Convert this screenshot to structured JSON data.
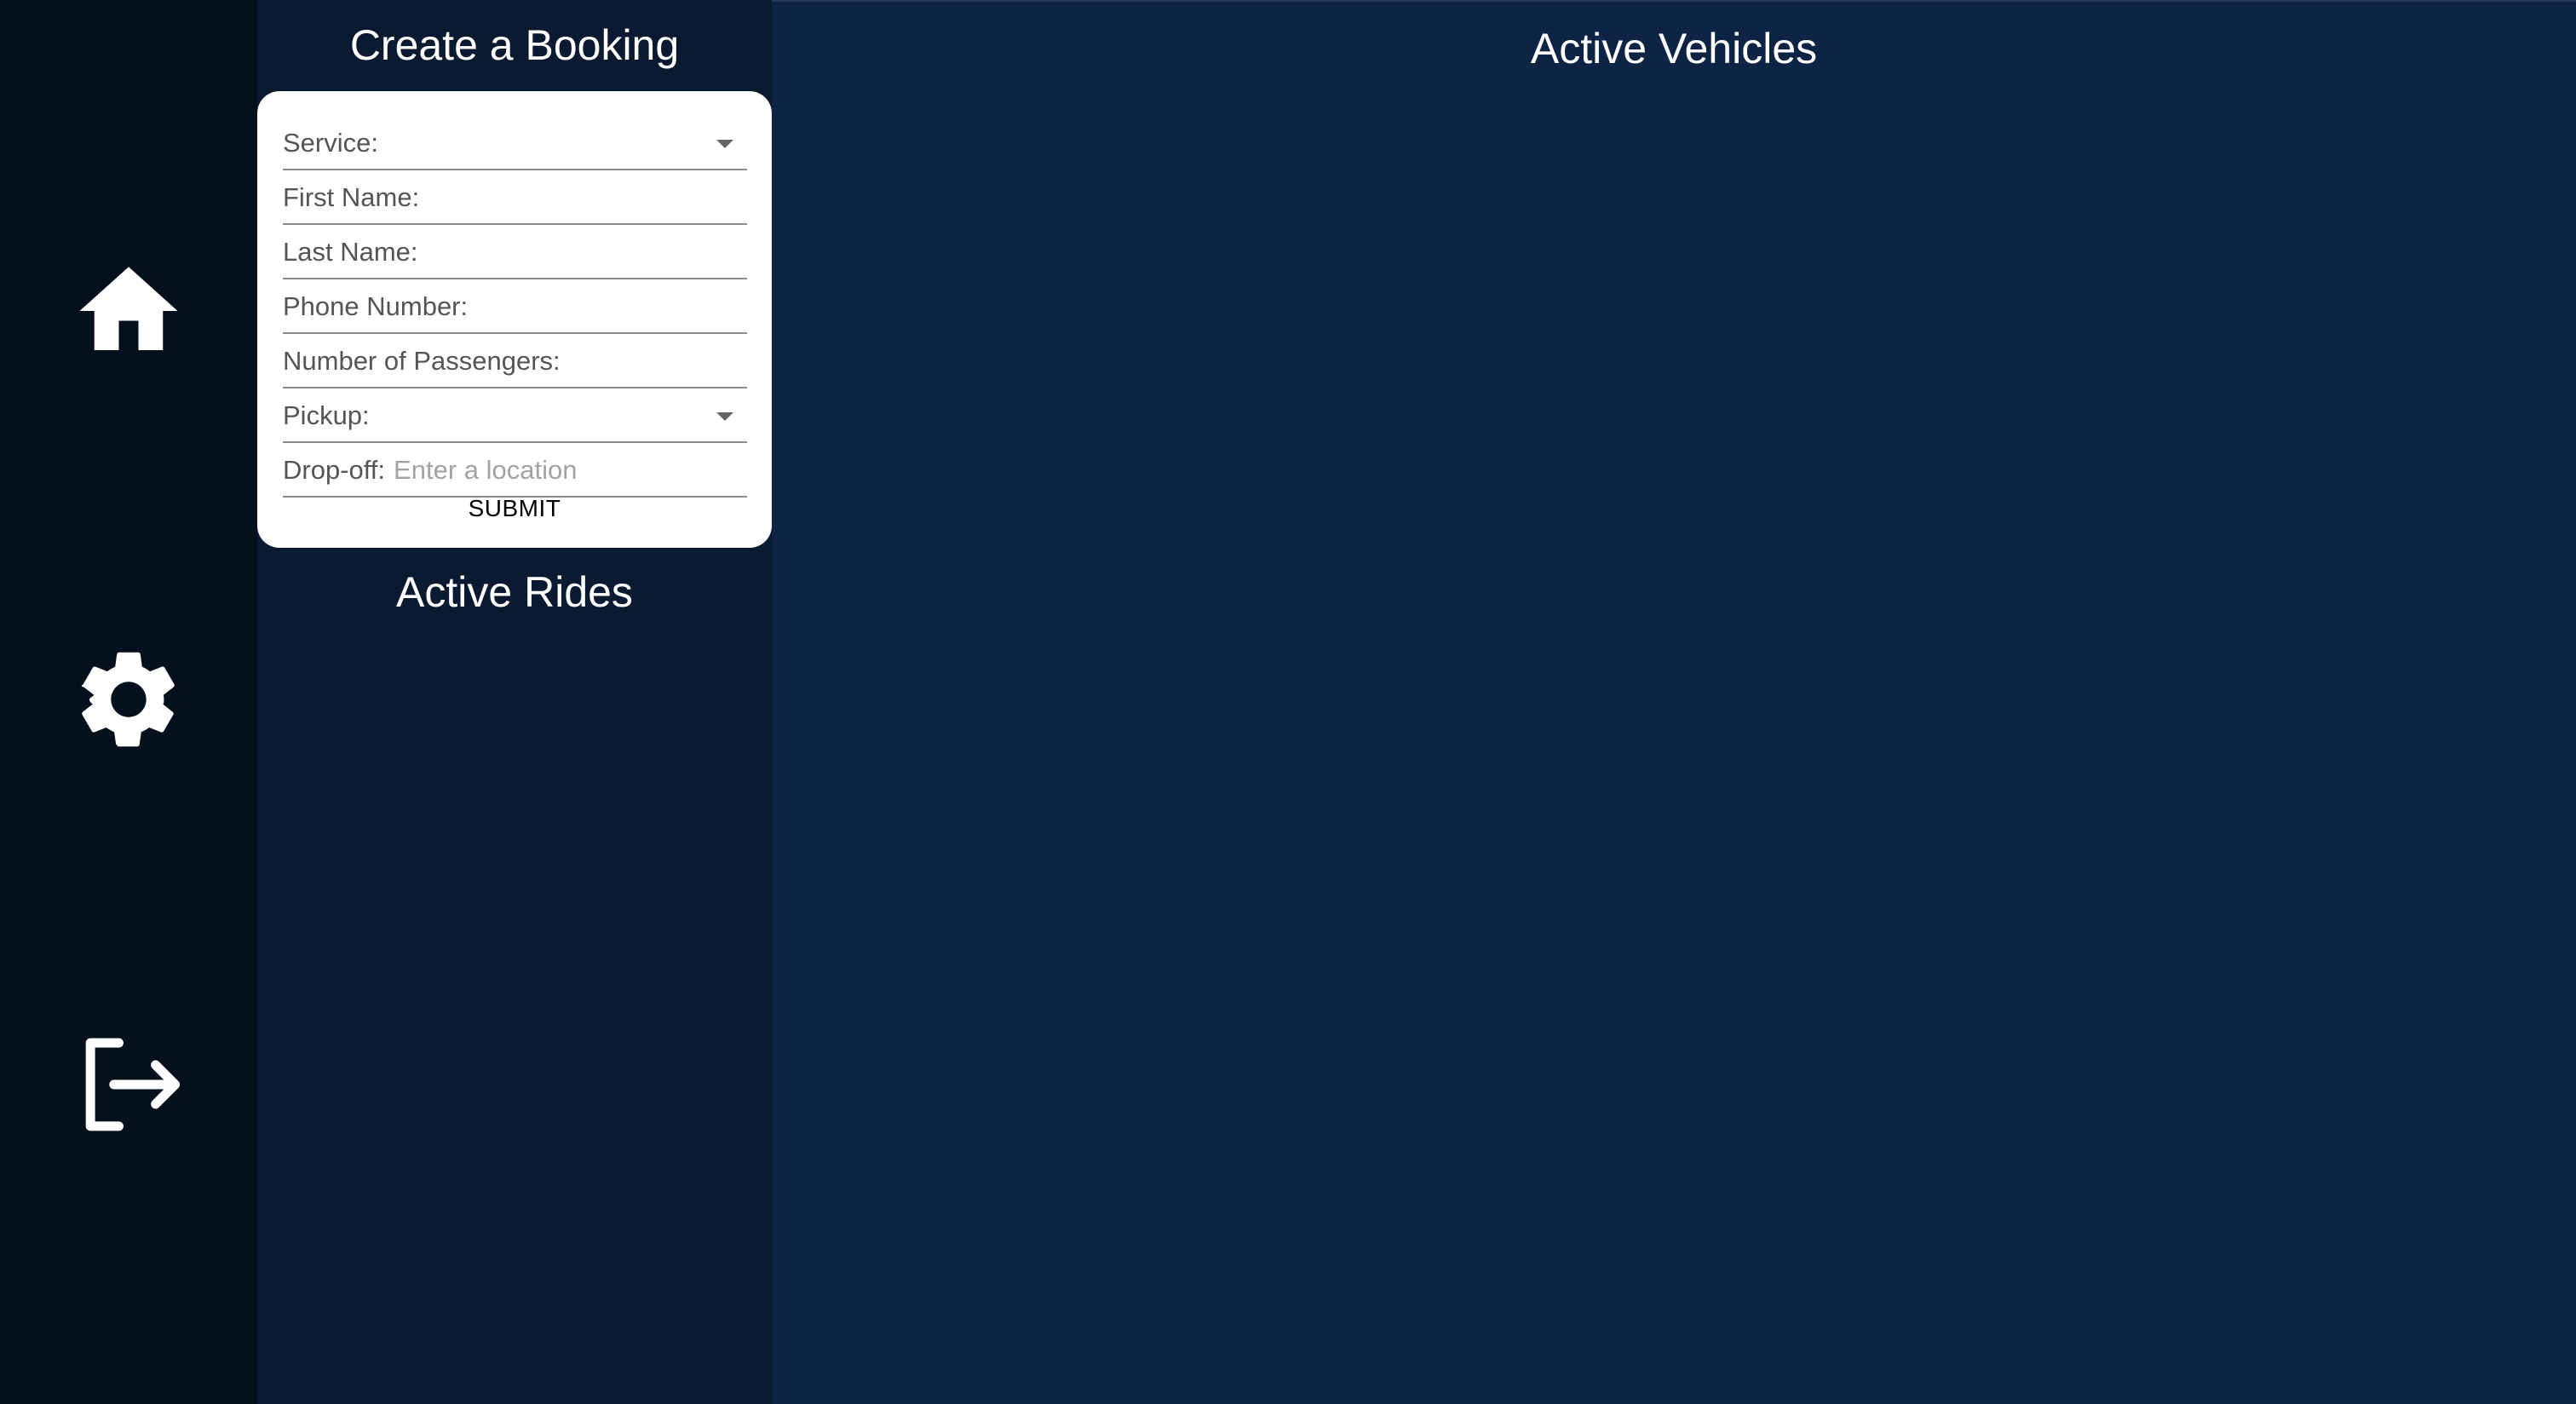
{
  "nav": {
    "items": [
      {
        "name": "home",
        "icon": "home-icon"
      },
      {
        "name": "settings",
        "icon": "gear-icon"
      },
      {
        "name": "logout",
        "icon": "logout-icon"
      }
    ]
  },
  "booking": {
    "title": "Create a Booking",
    "fields": {
      "service": {
        "label": "Service:",
        "value": ""
      },
      "first_name": {
        "label": "First Name:",
        "value": ""
      },
      "last_name": {
        "label": "Last Name:",
        "value": ""
      },
      "phone": {
        "label": "Phone Number:",
        "value": ""
      },
      "passengers": {
        "label": "Number of Passengers:",
        "value": ""
      },
      "pickup": {
        "label": "Pickup:",
        "value": ""
      },
      "dropoff": {
        "label": "Drop-off:",
        "placeholder": "Enter a location",
        "value": ""
      }
    },
    "submit_label": "SUBMIT"
  },
  "rides": {
    "title": "Active Rides"
  },
  "main": {
    "title": "Active Vehicles"
  },
  "colors": {
    "rail_bg": "#04111d",
    "panel_bg": "#0a1a30",
    "main_bg": "#0d2445",
    "card_bg": "#ffffff"
  }
}
